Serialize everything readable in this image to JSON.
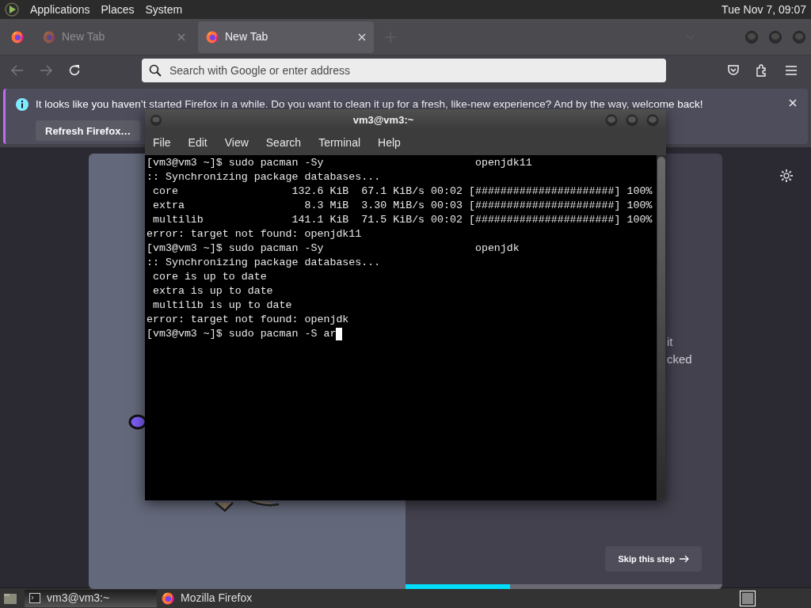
{
  "top_panel": {
    "menus": [
      "Applications",
      "Places",
      "System"
    ],
    "clock": "Tue Nov 7, 09:07"
  },
  "browser": {
    "tabs": [
      {
        "label": "New Tab",
        "selected": false
      },
      {
        "label": "New Tab",
        "selected": true
      }
    ],
    "url_placeholder": "Search with Google or enter address",
    "notification": {
      "message": "It looks like you haven’t started Firefox in a while. Do you want to clean it up for a fresh, like-new experience? And by the way, welcome back!",
      "button": "Refresh Firefox…"
    },
    "onboarding": {
      "fragments": [
        "it",
        "cked"
      ],
      "skip_button": "Skip this step",
      "progress": {
        "level": 0.33
      }
    }
  },
  "terminal": {
    "title": "vm3@vm3:~",
    "menus": [
      "File",
      "Edit",
      "View",
      "Search",
      "Terminal",
      "Help"
    ],
    "lines": [
      "[vm3@vm3 ~]$ sudo pacman -Sy                        openjdk11",
      ":: Synchronizing package databases...",
      " core                  132.6 KiB  67.1 KiB/s 00:02 [######################] 100%",
      " extra                   8.3 MiB  3.30 MiB/s 00:03 [######################] 100%",
      " multilib              141.1 KiB  71.5 KiB/s 00:02 [######################] 100%",
      "error: target not found: openjdk11",
      "[vm3@vm3 ~]$ sudo pacman -Sy                        openjdk",
      ":: Synchronizing package databases...",
      " core is up to date",
      " extra is up to date",
      " multilib is up to date",
      "error: target not found: openjdk",
      "[vm3@vm3 ~]$ sudo pacman -S ar"
    ]
  },
  "taskbar": {
    "tasks": [
      {
        "label": "vm3@vm3:~",
        "kind": "terminal",
        "selected": true
      },
      {
        "label": "Mozilla Firefox",
        "kind": "firefox",
        "selected": false
      }
    ]
  }
}
